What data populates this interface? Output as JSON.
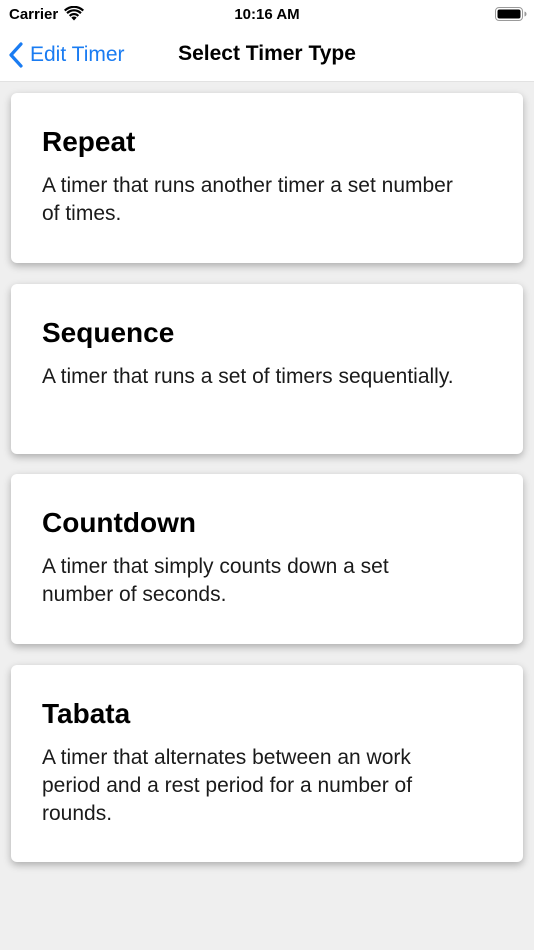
{
  "status_bar": {
    "carrier": "Carrier",
    "time": "10:16 AM",
    "wifi_icon": "wifi-icon",
    "battery_icon": "battery-icon"
  },
  "nav": {
    "back_label": "Edit Timer",
    "back_icon": "chevron-left-icon",
    "title": "Select Timer Type",
    "accent_color": "#1a7cf2"
  },
  "timer_types": [
    {
      "title": "Repeat",
      "description": "A timer that runs another timer a set number of times."
    },
    {
      "title": "Sequence",
      "description": "A timer that runs a set of timers sequentially."
    },
    {
      "title": "Countdown",
      "description": "A timer that simply counts down a set number of seconds."
    },
    {
      "title": "Tabata",
      "description": "A timer that alternates between an work period and a rest period for a number of rounds."
    }
  ]
}
